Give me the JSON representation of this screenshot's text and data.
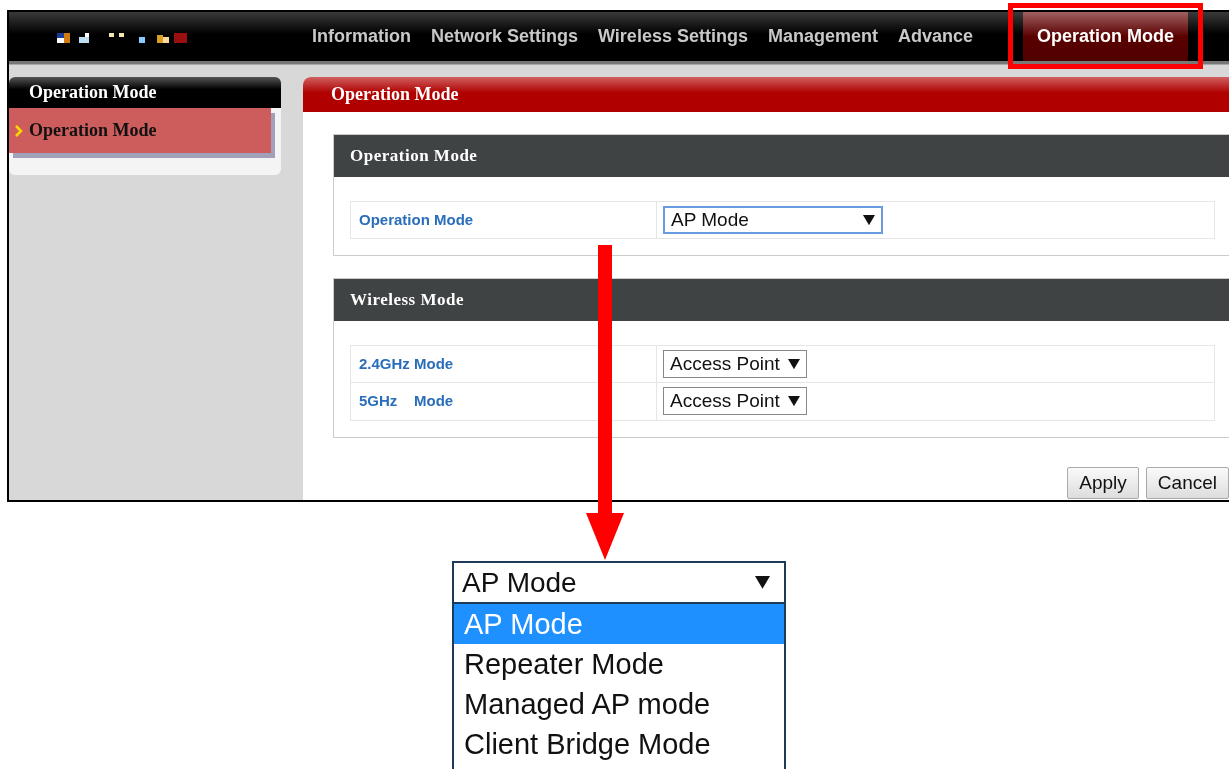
{
  "nav": {
    "items": [
      {
        "label": "Information",
        "selected": false
      },
      {
        "label": "Network Settings",
        "selected": false
      },
      {
        "label": "Wireless Settings",
        "selected": false
      },
      {
        "label": "Management",
        "selected": false
      },
      {
        "label": "Advance",
        "selected": false
      },
      {
        "label": "Operation Mode",
        "selected": true
      }
    ]
  },
  "sidebar": {
    "title": "Operation Mode",
    "items": [
      {
        "label": "Operation Mode",
        "selected": true
      }
    ]
  },
  "main": {
    "title": "Operation Mode",
    "sections": [
      {
        "title": "Operation Mode",
        "rows": [
          {
            "label": "Operation Mode",
            "value": "AP Mode"
          }
        ]
      },
      {
        "title": "Wireless Mode",
        "rows": [
          {
            "label": "2.4GHz Mode",
            "value": "Access Point"
          },
          {
            "label": "5GHz    Mode",
            "value": "Access Point"
          }
        ]
      }
    ],
    "buttons": [
      "Apply",
      "Cancel"
    ]
  },
  "dropdown_callout": {
    "value": "AP Mode",
    "options": [
      {
        "label": "AP Mode",
        "selected": true
      },
      {
        "label": "Repeater Mode",
        "selected": false
      },
      {
        "label": "Managed AP mode",
        "selected": false
      },
      {
        "label": "Client Bridge Mode",
        "selected": false
      }
    ]
  }
}
